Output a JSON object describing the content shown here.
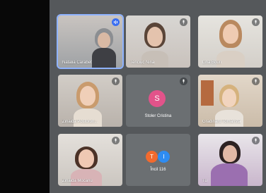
{
  "participants": [
    {
      "name": "Natalia Carabet",
      "speaking": true
    },
    {
      "name": "Tenciuc Nina",
      "speaking": false
    },
    {
      "name": "Lina Bouri",
      "speaking": false
    },
    {
      "name": "Zinaida Postoron...",
      "speaking": false
    },
    {
      "name": "Stoler Cristina",
      "speaking": false,
      "initial": "S",
      "avatar_color": "#e2538a"
    },
    {
      "name": "Gradinaru Tomarista",
      "speaking": false
    },
    {
      "name": "Zinaida Mocanu",
      "speaking": false
    },
    {
      "name": "Încil 116",
      "speaking": false,
      "initials": [
        "T",
        "I"
      ],
      "avatar_colors": [
        "#f26a2e",
        "#2e8cf2"
      ]
    },
    {
      "name": "Tu",
      "speaking": false
    }
  ],
  "colors": {
    "stage": "#55585b",
    "active_border": "#8fb3ff",
    "speaking_indicator": "#3a6ff2"
  }
}
